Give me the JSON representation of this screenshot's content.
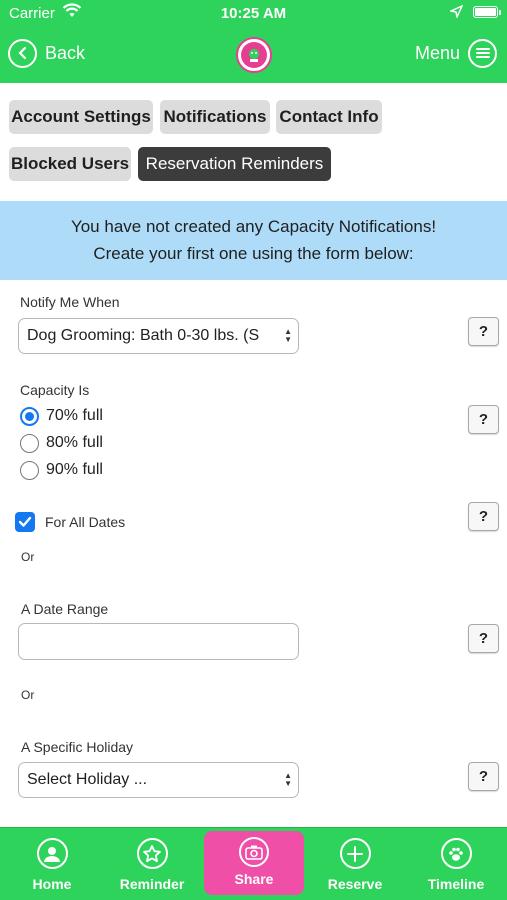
{
  "status_bar": {
    "carrier": "Carrier",
    "time": "10:25 AM"
  },
  "nav": {
    "back_label": "Back",
    "menu_label": "Menu"
  },
  "tabs": [
    {
      "label": "Account Settings",
      "active": false
    },
    {
      "label": "Notifications",
      "active": false
    },
    {
      "label": "Contact Info",
      "active": false
    },
    {
      "label": "Blocked Users",
      "active": false
    },
    {
      "label": "Reservation Reminders",
      "active": true
    }
  ],
  "notice": {
    "line1": "You have not created any Capacity Notifications!",
    "line2": "Create your first one using the form below:"
  },
  "form": {
    "notify_label": "Notify Me When",
    "notify_value": "Dog Grooming: Bath 0-30 lbs. (S",
    "capacity_label": "Capacity Is",
    "capacity_options": [
      "70% full",
      "80% full",
      "90% full"
    ],
    "capacity_selected": "70% full",
    "all_dates_label": "For All Dates",
    "all_dates_checked": true,
    "or_text": "Or",
    "date_range_label": "A Date Range",
    "date_range_value": "",
    "holiday_label": "A Specific Holiday",
    "holiday_value": "Select Holiday ...",
    "help_label": "?"
  },
  "tabbar": {
    "home": "Home",
    "reminder": "Reminder",
    "share": "Share",
    "reserve": "Reserve",
    "timeline": "Timeline"
  },
  "colors": {
    "brand_green": "#2ed35c",
    "share_pink": "#f04fa7",
    "notice_blue": "#aedcf8",
    "active_tab": "#3c3c3c",
    "accent_blue": "#1479f0"
  },
  "icons": {
    "back": "chevron-left-icon",
    "menu": "hamburger-icon",
    "home": "person-icon",
    "reminder": "star-icon",
    "share": "camera-icon",
    "reserve": "plus-icon",
    "timeline": "paw-icon"
  }
}
